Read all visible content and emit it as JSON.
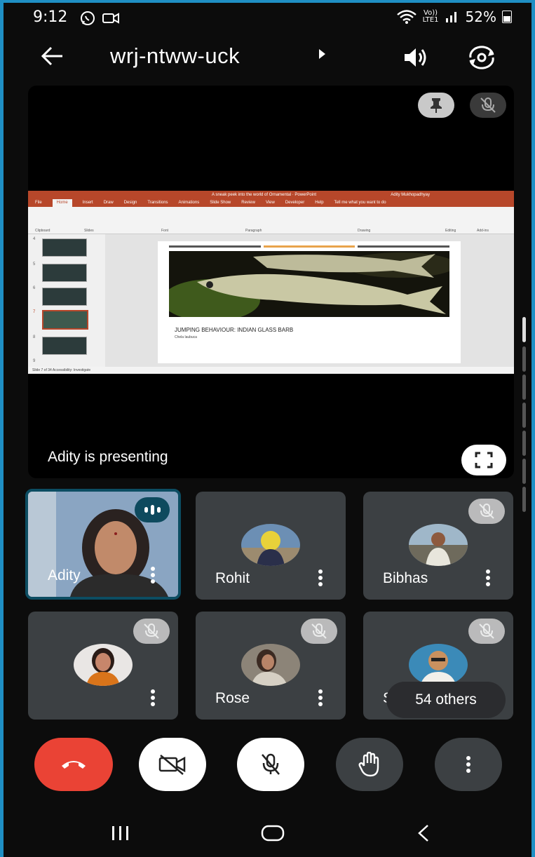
{
  "status": {
    "time": "9:12",
    "net_top": "Vo))",
    "net_bottom": "LTE1",
    "battery": "52%"
  },
  "header": {
    "meeting_code": "wrj-ntww-uck"
  },
  "presentation": {
    "ppt_title": "A sneak peek into the world of Ornamental · PowerPoint",
    "ppt_user": "Adity Mukhopadhyay",
    "ppt_tabs": [
      "File",
      "Home",
      "Insert",
      "Draw",
      "Design",
      "Transitions",
      "Animations",
      "Slide Show",
      "Review",
      "View",
      "Developer",
      "Help",
      "Tell me what you want to do"
    ],
    "ribbon_labels": [
      "Clipboard",
      "Slides",
      "Font",
      "Paragraph",
      "Drawing",
      "Editing",
      "Add-ins"
    ],
    "thumb_numbers": [
      "4",
      "5",
      "6",
      "7",
      "8",
      "9"
    ],
    "slide_caption": "JUMPING BEHAVIOUR: INDIAN GLASS BARB",
    "slide_sub": "Chela laubuca",
    "ppt_status": "Slide 7 of 34     Accessibility: Investigate",
    "presenting_text": "Adity is presenting"
  },
  "participants": [
    {
      "name": "Adity",
      "speaking": true
    },
    {
      "name": "Rohit"
    },
    {
      "name": "Bibhas"
    },
    {
      "name": ""
    },
    {
      "name": "Rose"
    },
    {
      "name": "Sa"
    }
  ],
  "others_label": "54 others",
  "colors": {
    "end_call": "#ea4335",
    "tile_bg": "#3c4043",
    "speaking_border": "#0c4d62"
  },
  "icons": [
    "back-arrow-icon",
    "speaker-icon",
    "flip-camera-icon",
    "pin-icon",
    "mic-off-icon",
    "fullscreen-icon",
    "more-vert-icon",
    "end-call-icon",
    "camera-off-icon",
    "raise-hand-icon"
  ]
}
